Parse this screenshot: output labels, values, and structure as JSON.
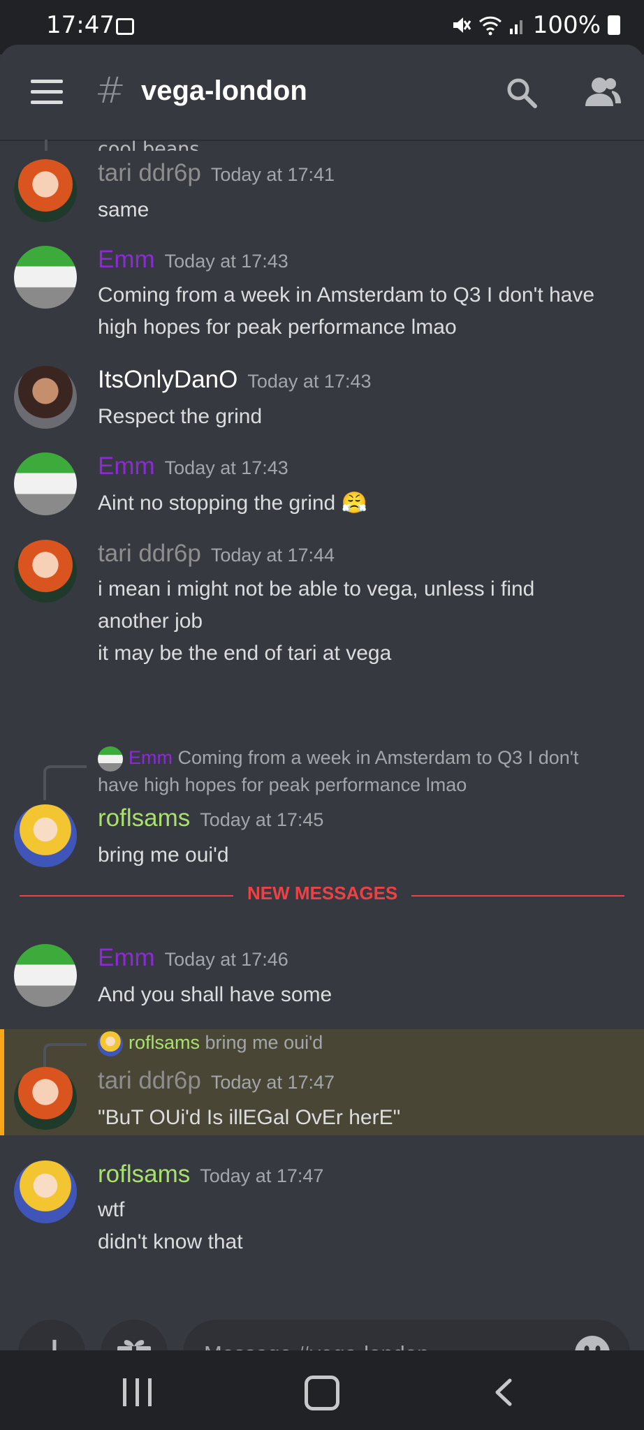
{
  "status_bar": {
    "time": "17:47",
    "battery": "100%",
    "icons": [
      "image-icon",
      "mute-icon",
      "wifi-icon",
      "signal-icon",
      "battery-icon"
    ]
  },
  "header": {
    "channel_name": "vega-london",
    "icons": [
      "menu-icon",
      "hash-icon",
      "search-icon",
      "members-icon"
    ]
  },
  "previous_text_fragment": "cool beans",
  "new_messages_label": "NEW MESSAGES",
  "messages": [
    {
      "author": "tari ddr6p",
      "time": "Today at 17:41",
      "lines": [
        "same"
      ]
    },
    {
      "author": "Emm",
      "time": "Today at 17:43",
      "lines": [
        "Coming from a week in Amsterdam to Q3 I don't have",
        "high hopes for peak performance lmao"
      ]
    },
    {
      "author": "ItsOnlyDanO",
      "time": "Today at 17:43",
      "lines": [
        "Respect the grind"
      ]
    },
    {
      "author": "Emm",
      "time": "Today at 17:43",
      "lines": [
        "Aint no stopping the grind 😤"
      ]
    },
    {
      "author": "tari ddr6p",
      "time": "Today at 17:44",
      "lines": [
        "i mean i might not be able to vega, unless i find",
        "another job",
        "it may be the end of tari at vega"
      ]
    },
    {
      "author": "roflsams",
      "time": "Today at 17:45",
      "lines": [
        "bring me oui'd"
      ],
      "reply_to": {
        "author": "Emm",
        "text": "Coming from a week in Amsterdam to Q3 I don't",
        "text2": "have high hopes for peak performance lmao"
      }
    },
    {
      "author": "Emm",
      "time": "Today at 17:46",
      "lines": [
        "And you shall have some"
      ]
    },
    {
      "author": "tari ddr6p",
      "time": "Today at 17:47",
      "lines": [
        "\"BuT OUi'd Is illEGal OvEr herE\""
      ],
      "reply_to": {
        "author": "roflsams",
        "text": "bring me oui'd"
      },
      "highlighted": true
    },
    {
      "author": "roflsams",
      "time": "Today at 17:47",
      "lines": [
        "wtf",
        "didn't know that"
      ]
    }
  ],
  "colors": {
    "tari": "#8e8e8e",
    "emm": "#8c2bd6",
    "dano": "#ffffff",
    "roflsams": "#a9e06f",
    "new_messages": "#ed4245",
    "mention_highlight": "#faa61a"
  },
  "composer": {
    "placeholder": "Message #vega-london",
    "icons": [
      "plus-icon",
      "gift-icon",
      "emoji-icon"
    ]
  },
  "nav_bar": {
    "icons": [
      "recent-apps-icon",
      "home-icon",
      "back-icon"
    ]
  }
}
